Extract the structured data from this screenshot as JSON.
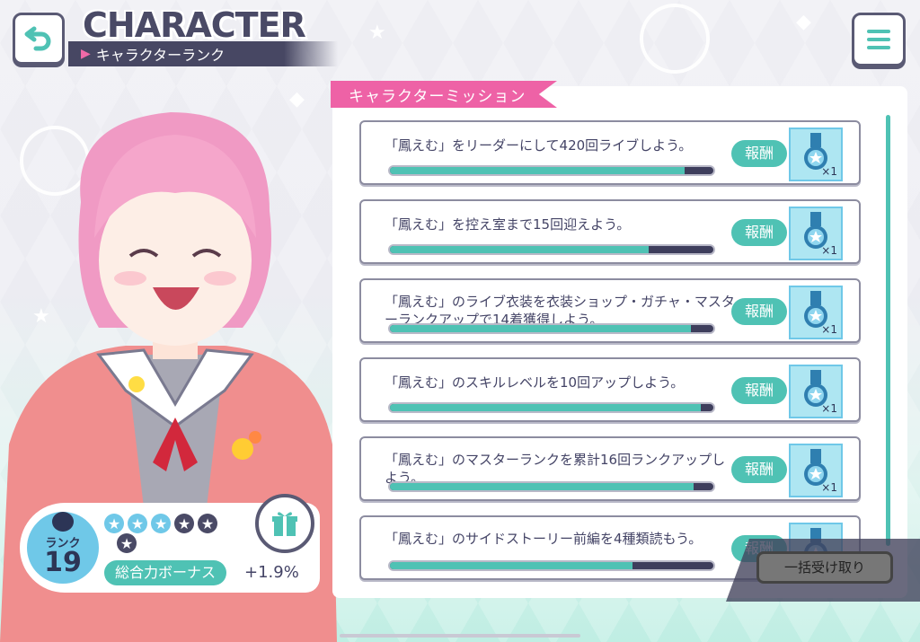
{
  "header": {
    "title_en": "CHARACTER",
    "subtitle": "キャラクターランク",
    "back_icon": "back-arrow-icon",
    "menu_icon": "hamburger-menu-icon"
  },
  "rank": {
    "label": "ランク",
    "value": "19",
    "stars_filled": 3,
    "stars_total": 6,
    "bonus_label": "総合力ボーナス",
    "bonus_value": "+1.9%",
    "gift_icon": "gift-icon"
  },
  "missions": {
    "header": "キャラクターミッション",
    "reward_label": "報酬",
    "items": [
      {
        "text": "「鳳えむ」をリーダーにして420回ライブしよう。",
        "progress": 0.91,
        "reward_qty": "×1"
      },
      {
        "text": "「鳳えむ」を控え室まで15回迎えよう。",
        "progress": 0.8,
        "reward_qty": "×1"
      },
      {
        "text": "「鳳えむ」のライブ衣装を衣装ショップ・ガチャ・マスターランクアップで14着獲得しよう。",
        "progress": 0.93,
        "reward_qty": "×1"
      },
      {
        "text": "「鳳えむ」のスキルレベルを10回アップしよう。",
        "progress": 0.96,
        "reward_qty": "×1"
      },
      {
        "text": "「鳳えむ」のマスターランクを累計16回ランクアップしよう。",
        "progress": 0.94,
        "reward_qty": "×1"
      },
      {
        "text": "「鳳えむ」のサイドストーリー前編を4種類読もう。",
        "progress": 0.75,
        "reward_qty": ""
      }
    ]
  },
  "claim_all": {
    "label": "一括受け取り"
  },
  "colors": {
    "accent_teal": "#4fc2b4",
    "accent_pink": "#ee62a6",
    "navy": "#474763",
    "rank_blue": "#6fc8e8"
  }
}
